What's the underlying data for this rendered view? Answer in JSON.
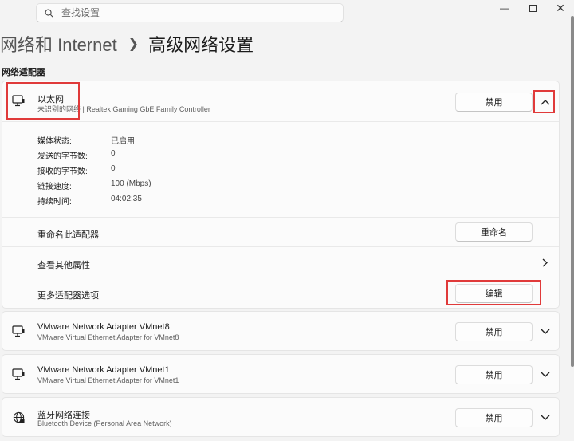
{
  "search": {
    "placeholder": "查找设置"
  },
  "breadcrumb": {
    "parent": "网络和 Internet",
    "current": "高级网络设置"
  },
  "section_title": "网络适配器",
  "ethernet": {
    "name": "以太网",
    "status_prefix": "未识别的网络",
    "description": "Realtek Gaming GbE Family Controller",
    "disable_label": "禁用",
    "details": [
      {
        "label": "媒体状态:",
        "value": "已启用"
      },
      {
        "label": "发送的字节数:",
        "value": "0"
      },
      {
        "label": "接收的字节数:",
        "value": "0"
      },
      {
        "label": "链接速度:",
        "value": "100 (Mbps)"
      },
      {
        "label": "持续时间:",
        "value": "04:02:35"
      }
    ],
    "rename_label": "重命名此适配器",
    "rename_button": "重命名",
    "more_props_label": "查看其他属性",
    "more_options_label": "更多适配器选项",
    "edit_button": "编辑"
  },
  "adapters": [
    {
      "name": "VMware Network Adapter VMnet8",
      "description": "VMware Virtual Ethernet Adapter for VMnet8",
      "button": "禁用",
      "icon": "monitor-icon"
    },
    {
      "name": "VMware Network Adapter VMnet1",
      "description": "VMware Virtual Ethernet Adapter for VMnet1",
      "button": "禁用",
      "icon": "monitor-icon"
    },
    {
      "name": "蓝牙网络连接",
      "description": "Bluetooth Device (Personal Area Network)",
      "button": "禁用",
      "icon": "globe-icon"
    }
  ],
  "colors": {
    "highlight": "#e03a3a",
    "background": "#f3f3f3",
    "card": "#fbfbfb"
  }
}
